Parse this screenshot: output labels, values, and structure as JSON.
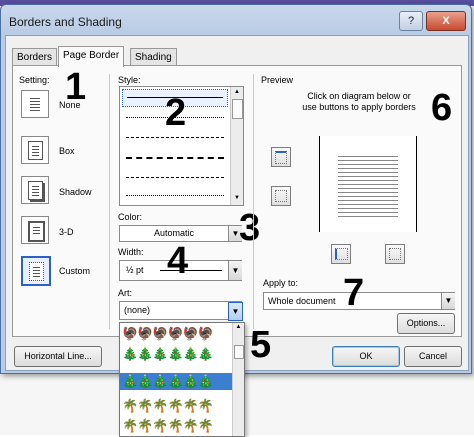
{
  "dialog": {
    "title": "Borders and Shading",
    "help_label": "?",
    "close_label": "X",
    "tabs": [
      "Borders",
      "Page Border",
      "Shading"
    ]
  },
  "setting": {
    "label": "Setting:",
    "options": [
      "None",
      "Box",
      "Shadow",
      "3-D",
      "Custom"
    ],
    "selected": "Custom"
  },
  "style": {
    "label": "Style:"
  },
  "color": {
    "label": "Color:",
    "value": "Automatic"
  },
  "width": {
    "label": "Width:",
    "value": "½ pt"
  },
  "art": {
    "label": "Art:",
    "value": "(none)"
  },
  "preview": {
    "label": "Preview",
    "instructions": "Click on diagram below or use buttons to apply borders"
  },
  "apply_to": {
    "label": "Apply to:",
    "value": "Whole document"
  },
  "buttons": {
    "options": "Options...",
    "horizontal_line": "Horizontal Line...",
    "ok": "OK",
    "cancel": "Cancel"
  },
  "annotations": [
    "1",
    "2",
    "3",
    "4",
    "5",
    "6",
    "7"
  ],
  "art_rows": [
    "🦃🦃🦃🦃🦃🦃",
    "🎄🎄🎄🎄🎄🎄",
    "🎄🎄🎄🎄🎄🎄",
    "🌴🌴🌴🌴🌴🌴",
    "🌴🌴🌴🌴🌴🌴",
    "✿✿✿✿✿✿✿✿"
  ],
  "colors": {
    "accent": "#2a62c8",
    "titlebar": "#b9cbe4",
    "close": "#c94a32",
    "art_selected": "#3b7fd0"
  }
}
